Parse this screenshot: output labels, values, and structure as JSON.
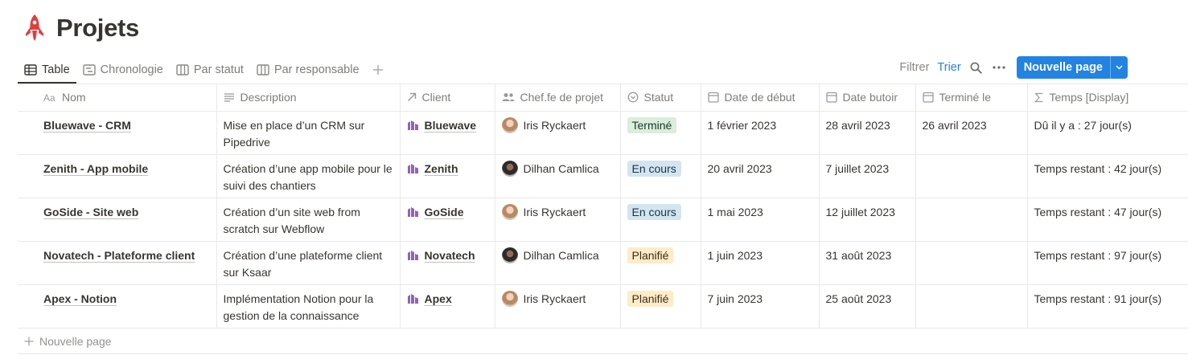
{
  "page": {
    "title": "Projets",
    "icon": "rocket-icon",
    "icon_color": "#e03e3e"
  },
  "views": {
    "tabs": [
      {
        "label": "Table",
        "icon": "table-icon",
        "active": true
      },
      {
        "label": "Chronologie",
        "icon": "timeline-icon",
        "active": false
      },
      {
        "label": "Par statut",
        "icon": "board-icon",
        "active": false
      },
      {
        "label": "Par responsable",
        "icon": "board-icon",
        "active": false
      }
    ],
    "add_view_icon": "plus-icon"
  },
  "toolbar": {
    "filter_label": "Filtrer",
    "sort_label": "Trier",
    "search_icon": "search-icon",
    "more_icon": "more-icon",
    "new_page_label": "Nouvelle page",
    "accent_color": "#2383e2"
  },
  "table": {
    "columns": [
      {
        "label": "Nom",
        "icon": "text-aa-icon"
      },
      {
        "label": "Description",
        "icon": "lines-icon"
      },
      {
        "label": "Client",
        "icon": "relation-arrow-icon"
      },
      {
        "label": "Chef.fe de projet",
        "icon": "people-icon"
      },
      {
        "label": "Statut",
        "icon": "status-icon"
      },
      {
        "label": "Date de début",
        "icon": "calendar-icon"
      },
      {
        "label": "Date butoir",
        "icon": "calendar-icon"
      },
      {
        "label": "Terminé le",
        "icon": "calendar-icon"
      },
      {
        "label": "Temps [Display]",
        "icon": "formula-sigma-icon"
      }
    ],
    "rows": [
      {
        "name": "Bluewave - CRM",
        "description": "Mise en place d’un CRM sur Pipedrive",
        "client": "Bluewave",
        "manager": "Iris Ryckaert",
        "status": "Terminé",
        "start": "1 février 2023",
        "due": "28 avril 2023",
        "done": "26 avril 2023",
        "time": "Dû il y a : 27 jour(s)"
      },
      {
        "name": "Zenith - App mobile",
        "description": "Création d’une app mobile pour le suivi des chantiers",
        "client": "Zenith",
        "manager": "Dilhan Camlica",
        "status": "En cours",
        "start": "20 avril 2023",
        "due": "7 juillet 2023",
        "done": "",
        "time": "Temps restant : 42 jour(s)"
      },
      {
        "name": "GoSide - Site web",
        "description": "Création d’un site web from scratch sur Webflow",
        "client": "GoSide",
        "manager": "Iris Ryckaert",
        "status": "En cours",
        "start": "1 mai 2023",
        "due": "12 juillet 2023",
        "done": "",
        "time": "Temps restant : 47 jour(s)"
      },
      {
        "name": "Novatech - Plateforme client",
        "description": "Création d’une plateforme client sur Ksaar",
        "client": "Novatech",
        "manager": "Dilhan Camlica",
        "status": "Planifié",
        "start": "1 juin 2023",
        "due": "31 août 2023",
        "done": "",
        "time": "Temps restant : 97 jour(s)"
      },
      {
        "name": "Apex - Notion",
        "description": "Implémentation Notion pour la gestion de la connaissance",
        "client": "Apex",
        "manager": "Iris Ryckaert",
        "status": "Planifié",
        "start": "7 juin 2023",
        "due": "25 août 2023",
        "done": "",
        "time": "Temps restant : 91 jour(s)"
      }
    ],
    "new_row_label": "Nouvelle page"
  },
  "status_colors": {
    "Terminé": {
      "bg": "#dbeddb",
      "fg": "#1c3829"
    },
    "En cours": {
      "bg": "#d3e5ef",
      "fg": "#183347"
    },
    "Planifié": {
      "bg": "#fdecc8",
      "fg": "#402c1b"
    }
  },
  "client_icon_color": "#9065b0"
}
